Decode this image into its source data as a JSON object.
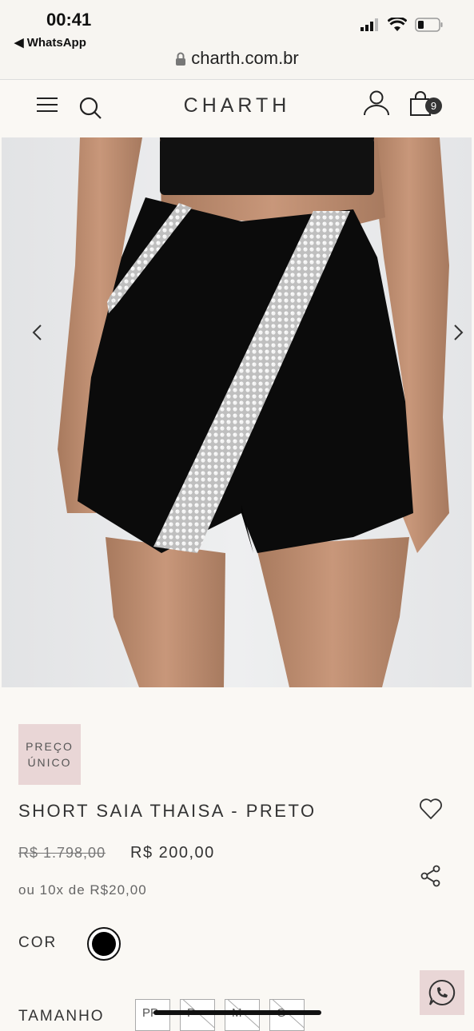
{
  "status": {
    "time": "00:41",
    "back_app": "◀ WhatsApp",
    "url": "charth.com.br"
  },
  "header": {
    "brand": "CHARTH",
    "cart_count": "9"
  },
  "product": {
    "badge": "PREÇO ÚNICO",
    "title": "SHORT SAIA THAISA - PRETO",
    "old_price": "R$ 1.798,00",
    "price": "R$ 200,00",
    "installments": "ou 10x de R$20,00",
    "color_label": "COR",
    "color_value": "#000000",
    "size_label": "TAMANHO",
    "sizes": [
      "PP",
      "P",
      "M",
      "G"
    ]
  },
  "colors": {
    "accent": "#e9d6d6",
    "background": "#faf8f4"
  }
}
